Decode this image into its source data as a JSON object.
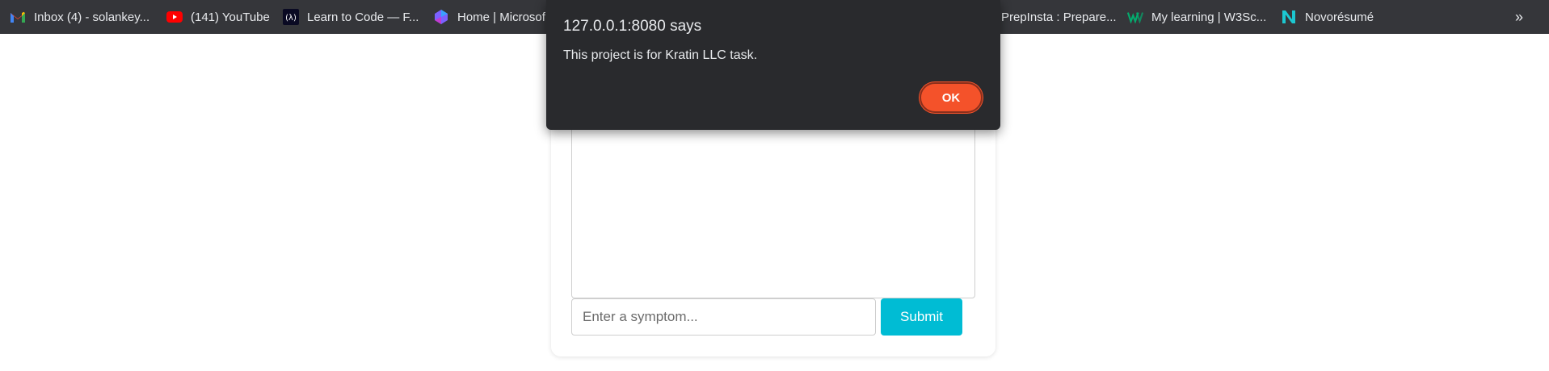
{
  "bookmarks": {
    "items": [
      {
        "label": "Inbox (4) - solankey...",
        "icon": "gmail-icon"
      },
      {
        "label": "(141) YouTube",
        "icon": "youtube-icon"
      },
      {
        "label": "Learn to Code — F...",
        "icon": "freecodecamp-icon"
      },
      {
        "label": "Home | Microsof",
        "icon": "microsoft-icon"
      },
      {
        "label": "PrepInsta : Prepare...",
        "icon": "prepinsta-icon"
      },
      {
        "label": "My learning | W3Sc...",
        "icon": "w3schools-icon"
      },
      {
        "label": "Novorésumé",
        "icon": "novoresume-icon"
      }
    ],
    "more_label": "»"
  },
  "dialog": {
    "title": "127.0.0.1:8080 says",
    "message": "This project is for Kratin LLC task.",
    "ok_label": "OK"
  },
  "chat": {
    "input_placeholder": "Enter a symptom...",
    "input_value": "",
    "submit_label": "Submit"
  },
  "colors": {
    "bookmarks_bg": "#35363a",
    "dialog_bg": "#292a2d",
    "ok_button": "#f4522a",
    "submit_button": "#00bcd4"
  }
}
